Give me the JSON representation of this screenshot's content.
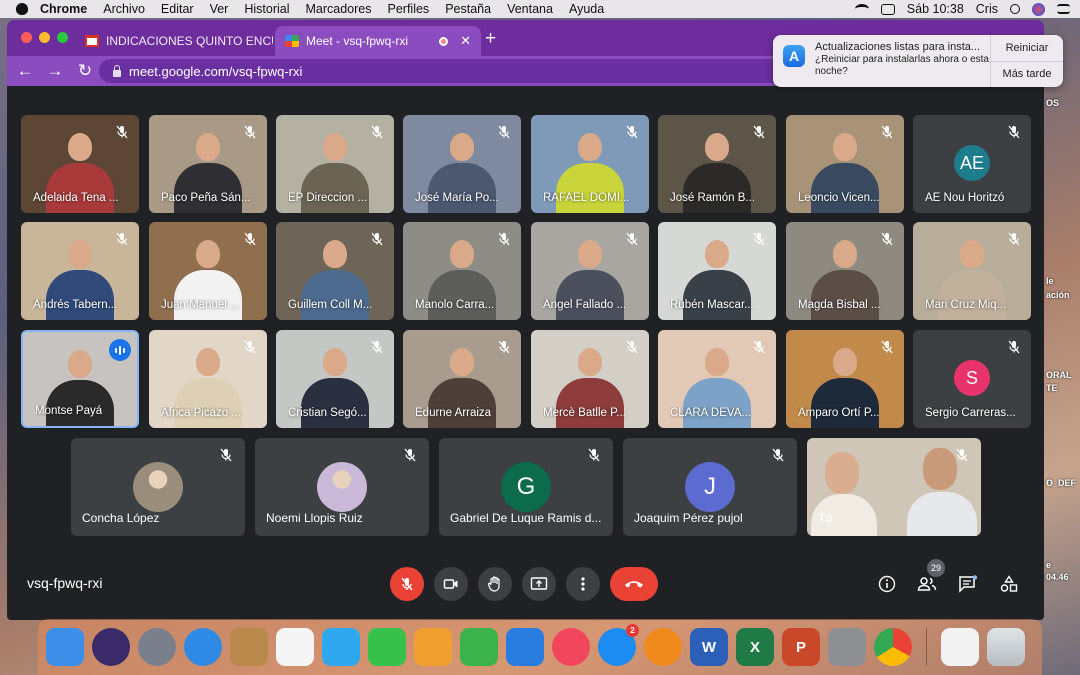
{
  "menubar": {
    "items": [
      "Chrome",
      "Archivo",
      "Editar",
      "Ver",
      "Historial",
      "Marcadores",
      "Perfiles",
      "Pestaña",
      "Ventana",
      "Ayuda"
    ],
    "clock": "Sáb 10:38",
    "user": "Cris"
  },
  "browser": {
    "tabs": [
      {
        "title": "INDICACIONES QUINTO ENCUE",
        "icon": "gmail-icon"
      },
      {
        "title": "Meet - vsq-fpwq-rxi",
        "icon": "meet-icon"
      }
    ],
    "url": "meet.google.com/vsq-fpwq-rxi"
  },
  "notification": {
    "title": "Actualizaciones listas para insta...",
    "body": "¿Reiniciar para instalarlas ahora o esta noche?",
    "restart_label": "Reiniciar",
    "later_label": "Más tarde"
  },
  "participants_row1": [
    {
      "name": "Adelaida Tena ...",
      "video": true,
      "bg": "#5e4636",
      "shirt": "#a83a3a"
    },
    {
      "name": "Paco Peña Sán...",
      "video": true,
      "bg": "#a89a86",
      "shirt": "#2f2f34"
    },
    {
      "name": "EP Direccion ...",
      "video": true,
      "bg": "#b4b0a2",
      "shirt": "#6b6454"
    },
    {
      "name": "José María Po...",
      "video": true,
      "bg": "#7f8aa0",
      "shirt": "#4b5870"
    },
    {
      "name": "RAFAEL DOMI...",
      "video": true,
      "bg": "#7f9ab8",
      "shirt": "#c8d43a"
    },
    {
      "name": "José Ramón B...",
      "video": true,
      "bg": "#5c5548",
      "shirt": "#2c2a28"
    },
    {
      "name": "Leoncio Vicen...",
      "video": true,
      "bg": "#a89378",
      "shirt": "#394a60"
    },
    {
      "name": "AE Nou Horitzó",
      "video": false,
      "initials": "AE",
      "color": "#1e7d8d"
    }
  ],
  "participants_row2": [
    {
      "name": "Andrés Tabern...",
      "video": true,
      "bg": "#c9b69a",
      "shirt": "#314a7a"
    },
    {
      "name": "Juan Manuel ...",
      "video": true,
      "bg": "#8f6f4e",
      "shirt": "#f2f2f2"
    },
    {
      "name": "Guillem Coll M...",
      "video": true,
      "bg": "#6e6558",
      "shirt": "#4d6a8f"
    },
    {
      "name": "Manolo Carra...",
      "video": true,
      "bg": "#8d8d86",
      "shirt": "#5d5d5a"
    },
    {
      "name": "Ángel Fallado ...",
      "video": true,
      "bg": "#a9a6a2",
      "shirt": "#4c4f5c"
    },
    {
      "name": "Rubén Mascar...",
      "video": true,
      "bg": "#d6d8d5",
      "shirt": "#3a4048"
    },
    {
      "name": "Magda Bisbal ...",
      "video": true,
      "bg": "#8f8a7f",
      "shirt": "#5b4e46"
    },
    {
      "name": "Mari Cruz Miq...",
      "video": true,
      "bg": "#b7ad98",
      "shirt": "#c0b09c"
    }
  ],
  "participants_row3": [
    {
      "name": "Montse Payá",
      "video": true,
      "bg": "#c7c3c0",
      "shirt": "#2a2a2a",
      "speaking": true
    },
    {
      "name": "Àfrica Picazo ...",
      "video": true,
      "bg": "#e2d6c8",
      "shirt": "#ddd0b4"
    },
    {
      "name": "Cristian Segó...",
      "video": true,
      "bg": "#c4c8c4",
      "shirt": "#2a3040"
    },
    {
      "name": "Edurne Arraiza",
      "video": true,
      "bg": "#a89c8e",
      "shirt": "#4e4038"
    },
    {
      "name": "Mercè Batlle P...",
      "video": true,
      "bg": "#d3cfc7",
      "shirt": "#8e3c3c"
    },
    {
      "name": "CLARA DEVA...",
      "video": true,
      "bg": "#e1c9b6",
      "shirt": "#7da2c7"
    },
    {
      "name": "Amparo Ortí P...",
      "video": true,
      "bg": "#c28a4a",
      "shirt": "#1e2a3a"
    },
    {
      "name": "Sergio Carreras...",
      "video": false,
      "initials": "S",
      "color": "#e8336d"
    }
  ],
  "participants_row4": [
    {
      "name": "Concha López",
      "avatar": "photo",
      "color": "#9a8d7c"
    },
    {
      "name": "Noemi Llopis Ruiz",
      "avatar": "photo",
      "color": "#c9b8d8"
    },
    {
      "name": "Gabriel De Luque Ramis d...",
      "avatar": "letter",
      "initials": "G",
      "color": "#0b6b4a"
    },
    {
      "name": "Joaquim Pérez pujol",
      "avatar": "letter",
      "initials": "J",
      "color": "#5b6bd0"
    }
  ],
  "self_tile": {
    "name": "Tú"
  },
  "meeting": {
    "code": "vsq-fpwq-rxi",
    "participant_count": "29"
  },
  "desktop_side_text": [
    "OS",
    "le",
    "ación",
    "ORAL",
    "TE",
    "O_DEF",
    "e",
    "04.46"
  ],
  "dock_apps": [
    {
      "name": "finder",
      "color": "#3d8ee8"
    },
    {
      "name": "siri",
      "color": "#3a2a6a"
    },
    {
      "name": "launchpad",
      "color": "#7a7f8c"
    },
    {
      "name": "safari",
      "color": "#2f8ae6"
    },
    {
      "name": "contacts",
      "color": "#b8894a"
    },
    {
      "name": "reminders",
      "color": "#f5f5f5"
    },
    {
      "name": "messages",
      "color": "#2fa8f0"
    },
    {
      "name": "facetime",
      "color": "#36c24a"
    },
    {
      "name": "pages",
      "color": "#f0a030"
    },
    {
      "name": "numbers",
      "color": "#3bb24a"
    },
    {
      "name": "keynote",
      "color": "#2a7de0"
    },
    {
      "name": "music",
      "color": "#f2465d"
    },
    {
      "name": "app-store",
      "color": "#1d8cf0",
      "badge": "2"
    },
    {
      "name": "books",
      "color": "#f08a1c"
    },
    {
      "name": "word",
      "color": "#2b5fb8",
      "letter": "W"
    },
    {
      "name": "excel",
      "color": "#1f7a45",
      "letter": "X"
    },
    {
      "name": "powerpoint",
      "color": "#c9482a",
      "letter": "P"
    },
    {
      "name": "system-preferences",
      "color": "#8d8f93"
    },
    {
      "name": "chrome",
      "color": "#f5f5f5"
    }
  ]
}
